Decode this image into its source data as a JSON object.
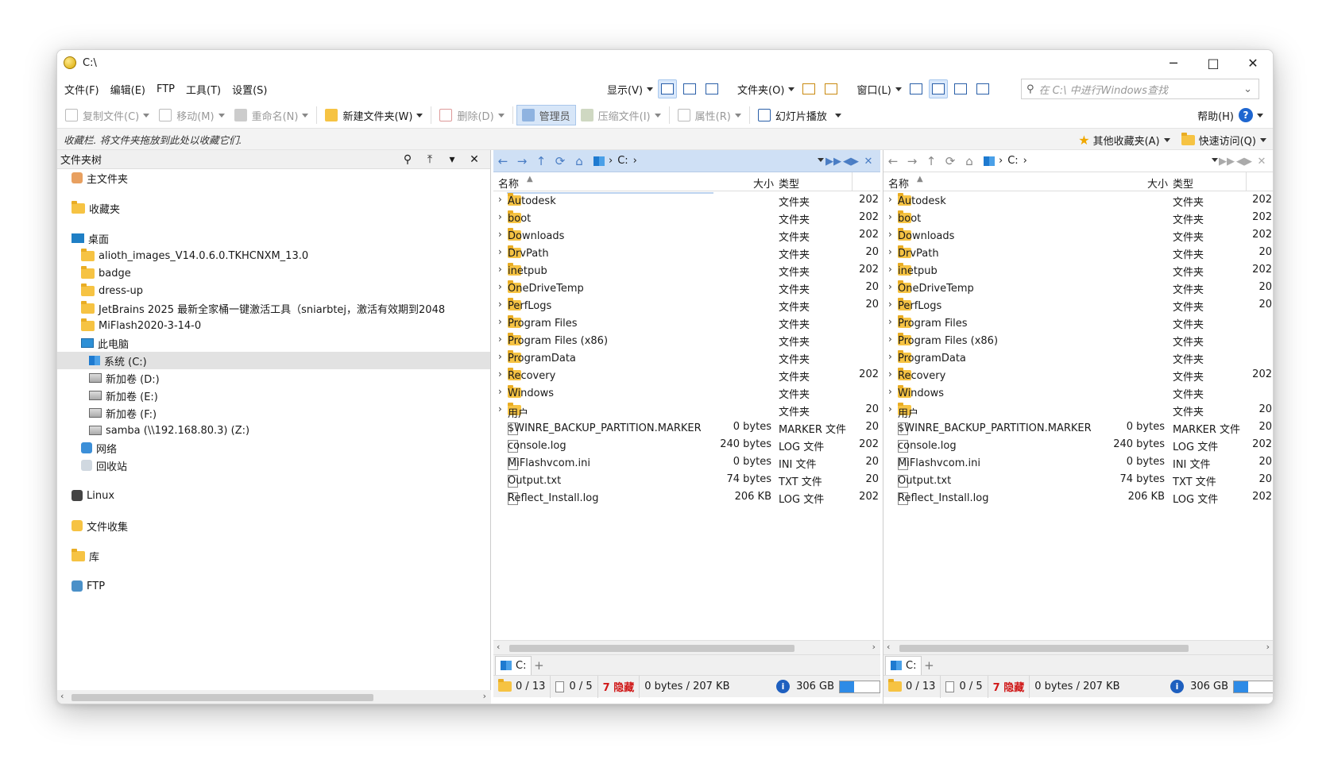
{
  "window": {
    "title": "C:\\",
    "minimize": "─",
    "maximize": "□",
    "close": "✕"
  },
  "menu": [
    "文件(F)",
    "编辑(E)",
    "FTP",
    "工具(T)",
    "设置(S)"
  ],
  "menu_right": {
    "display": "显示(V)",
    "folder": "文件夹(O)",
    "window": "窗口(L)"
  },
  "search": {
    "placeholder": "在 C:\\ 中进行Windows查找"
  },
  "toolbar": {
    "copy": "复制文件(C)",
    "move": "移动(M)",
    "rename": "重命名(N)",
    "newfolder": "新建文件夹(W)",
    "delete": "删除(D)",
    "admin": "管理员",
    "compress": "压缩文件(I)",
    "properties": "属性(R)",
    "slideshow": "幻灯片播放",
    "help": "帮助(H)"
  },
  "favbar": {
    "text": "收藏栏. 将文件夹拖放到此处以收藏它们.",
    "other": "其他收藏夹(A)",
    "quick": "快速访问(Q)"
  },
  "treepanel": {
    "title": "文件夹树"
  },
  "tree": [
    {
      "label": "主文件夹",
      "icon": "home-icon"
    },
    {
      "label": "收藏夹",
      "icon": "folder-icon"
    },
    {
      "label": "桌面",
      "icon": "desktop-icon"
    },
    {
      "label": "alioth_images_V14.0.6.0.TKHCNXM_13.0",
      "icon": "folder-icon"
    },
    {
      "label": "badge",
      "icon": "folder-icon"
    },
    {
      "label": "dress-up",
      "icon": "folder-icon"
    },
    {
      "label": "JetBrains 2025 最新全家桶一键激活工具（sniarbtej，激活有效期到2048",
      "icon": "folder-icon"
    },
    {
      "label": "MiFlash2020-3-14-0",
      "icon": "folder-icon"
    },
    {
      "label": "此电脑",
      "icon": "pc-icon"
    },
    {
      "label": "系统 (C:)",
      "icon": "system-drive-icon"
    },
    {
      "label": "新加卷 (D:)",
      "icon": "drive-icon"
    },
    {
      "label": "新加卷 (E:)",
      "icon": "drive-icon"
    },
    {
      "label": "新加卷 (F:)",
      "icon": "drive-icon"
    },
    {
      "label": "samba (\\\\192.168.80.3) (Z:)",
      "icon": "network-drive-icon"
    },
    {
      "label": "网络",
      "icon": "network-icon"
    },
    {
      "label": "回收站",
      "icon": "recycle-bin-icon"
    },
    {
      "label": "Linux",
      "icon": "linux-icon"
    },
    {
      "label": "文件收集",
      "icon": "collection-icon"
    },
    {
      "label": "库",
      "icon": "library-icon"
    },
    {
      "label": "FTP",
      "icon": "ftp-icon"
    }
  ],
  "pane": {
    "path": "C:",
    "col_name": "名称",
    "col_size": "大小",
    "col_type": "类型",
    "tab": "C:",
    "tab_plus": "+"
  },
  "files": [
    {
      "name": "Autodesk",
      "size": "",
      "type": "文件夹",
      "date_l": "202",
      "date_r": "202",
      "dir": true
    },
    {
      "name": "boot",
      "size": "",
      "type": "文件夹",
      "date_l": "202",
      "date_r": "202",
      "dir": true
    },
    {
      "name": "Downloads",
      "size": "",
      "type": "文件夹",
      "date_l": "202",
      "date_r": "202",
      "dir": true
    },
    {
      "name": "DrvPath",
      "size": "",
      "type": "文件夹",
      "date_l": "20",
      "date_r": "20",
      "dir": true
    },
    {
      "name": "inetpub",
      "size": "",
      "type": "文件夹",
      "date_l": "202",
      "date_r": "202",
      "dir": true
    },
    {
      "name": "OneDriveTemp",
      "size": "",
      "type": "文件夹",
      "date_l": "20",
      "date_r": "20",
      "dir": true
    },
    {
      "name": "PerfLogs",
      "size": "",
      "type": "文件夹",
      "date_l": "20",
      "date_r": "20",
      "dir": true
    },
    {
      "name": "Program Files",
      "size": "",
      "type": "文件夹",
      "date_l": "",
      "date_r": "",
      "dir": true
    },
    {
      "name": "Program Files (x86)",
      "size": "",
      "type": "文件夹",
      "date_l": "",
      "date_r": "",
      "dir": true
    },
    {
      "name": "ProgramData",
      "size": "",
      "type": "文件夹",
      "date_l": "",
      "date_r": "",
      "dir": true
    },
    {
      "name": "Recovery",
      "size": "",
      "type": "文件夹",
      "date_l": "202",
      "date_r": "202",
      "dir": true
    },
    {
      "name": "Windows",
      "size": "",
      "type": "文件夹",
      "date_l": "",
      "date_r": "",
      "dir": true
    },
    {
      "name": "用户",
      "size": "",
      "type": "文件夹",
      "date_l": "20",
      "date_r": "20",
      "dir": true
    },
    {
      "name": "$WINRE_BACKUP_PARTITION.MARKER",
      "size": "0 bytes",
      "type": "MARKER 文件",
      "date_l": "20",
      "date_r": "20",
      "dir": false
    },
    {
      "name": "console.log",
      "size": "240 bytes",
      "type": "LOG 文件",
      "date_l": "202",
      "date_r": "202",
      "dir": false
    },
    {
      "name": "MiFlashvcom.ini",
      "size": "0 bytes",
      "type": "INI 文件",
      "date_l": "20",
      "date_r": "20",
      "dir": false
    },
    {
      "name": "Output.txt",
      "size": "74 bytes",
      "type": "TXT 文件",
      "date_l": "20",
      "date_r": "20",
      "dir": false
    },
    {
      "name": "Reflect_Install.log",
      "size": "206 KB",
      "type": "LOG 文件",
      "date_l": "202",
      "date_r": "202",
      "dir": false
    }
  ],
  "status": {
    "folders": "0 / 13",
    "files": "0 / 5",
    "hidden": "7 隐藏",
    "bytes": "0 bytes / 207 KB",
    "free": "306 GB",
    "used_fraction": 0.35
  },
  "colors": {
    "accent": "#2e8be6",
    "active_addr": "#cfe0f5",
    "hidden": "#d01818"
  }
}
